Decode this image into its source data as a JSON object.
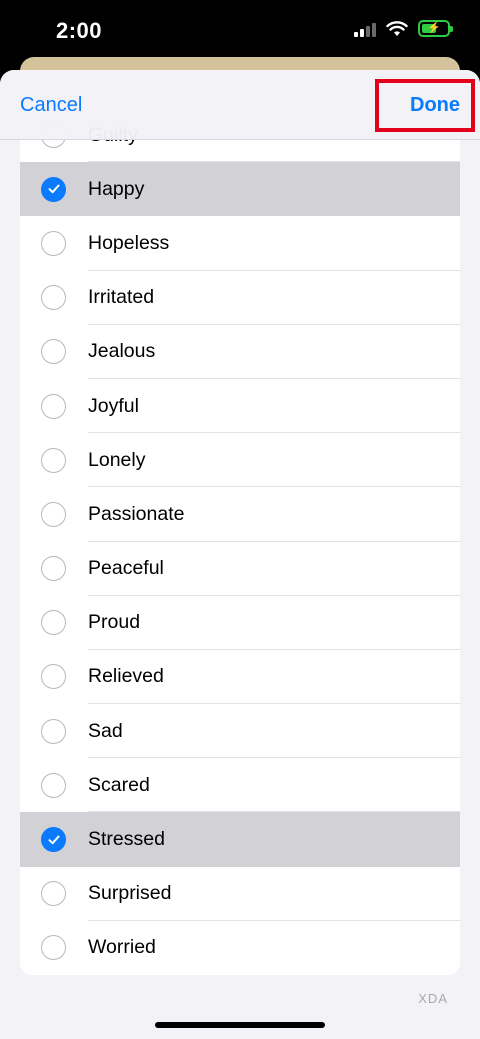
{
  "status": {
    "time": "2:00"
  },
  "nav": {
    "cancel_label": "Cancel",
    "done_label": "Done"
  },
  "list": {
    "items": [
      {
        "label": "Guilty",
        "checked": false
      },
      {
        "label": "Happy",
        "checked": true
      },
      {
        "label": "Hopeless",
        "checked": false
      },
      {
        "label": "Irritated",
        "checked": false
      },
      {
        "label": "Jealous",
        "checked": false
      },
      {
        "label": "Joyful",
        "checked": false
      },
      {
        "label": "Lonely",
        "checked": false
      },
      {
        "label": "Passionate",
        "checked": false
      },
      {
        "label": "Peaceful",
        "checked": false
      },
      {
        "label": "Proud",
        "checked": false
      },
      {
        "label": "Relieved",
        "checked": false
      },
      {
        "label": "Sad",
        "checked": false
      },
      {
        "label": "Scared",
        "checked": false
      },
      {
        "label": "Stressed",
        "checked": true
      },
      {
        "label": "Surprised",
        "checked": false
      },
      {
        "label": "Worried",
        "checked": false
      }
    ]
  },
  "watermark": "XDA",
  "colors": {
    "accent": "#0a7aff",
    "highlight": "#e3001b",
    "selected_row": "#d1d1d6"
  }
}
